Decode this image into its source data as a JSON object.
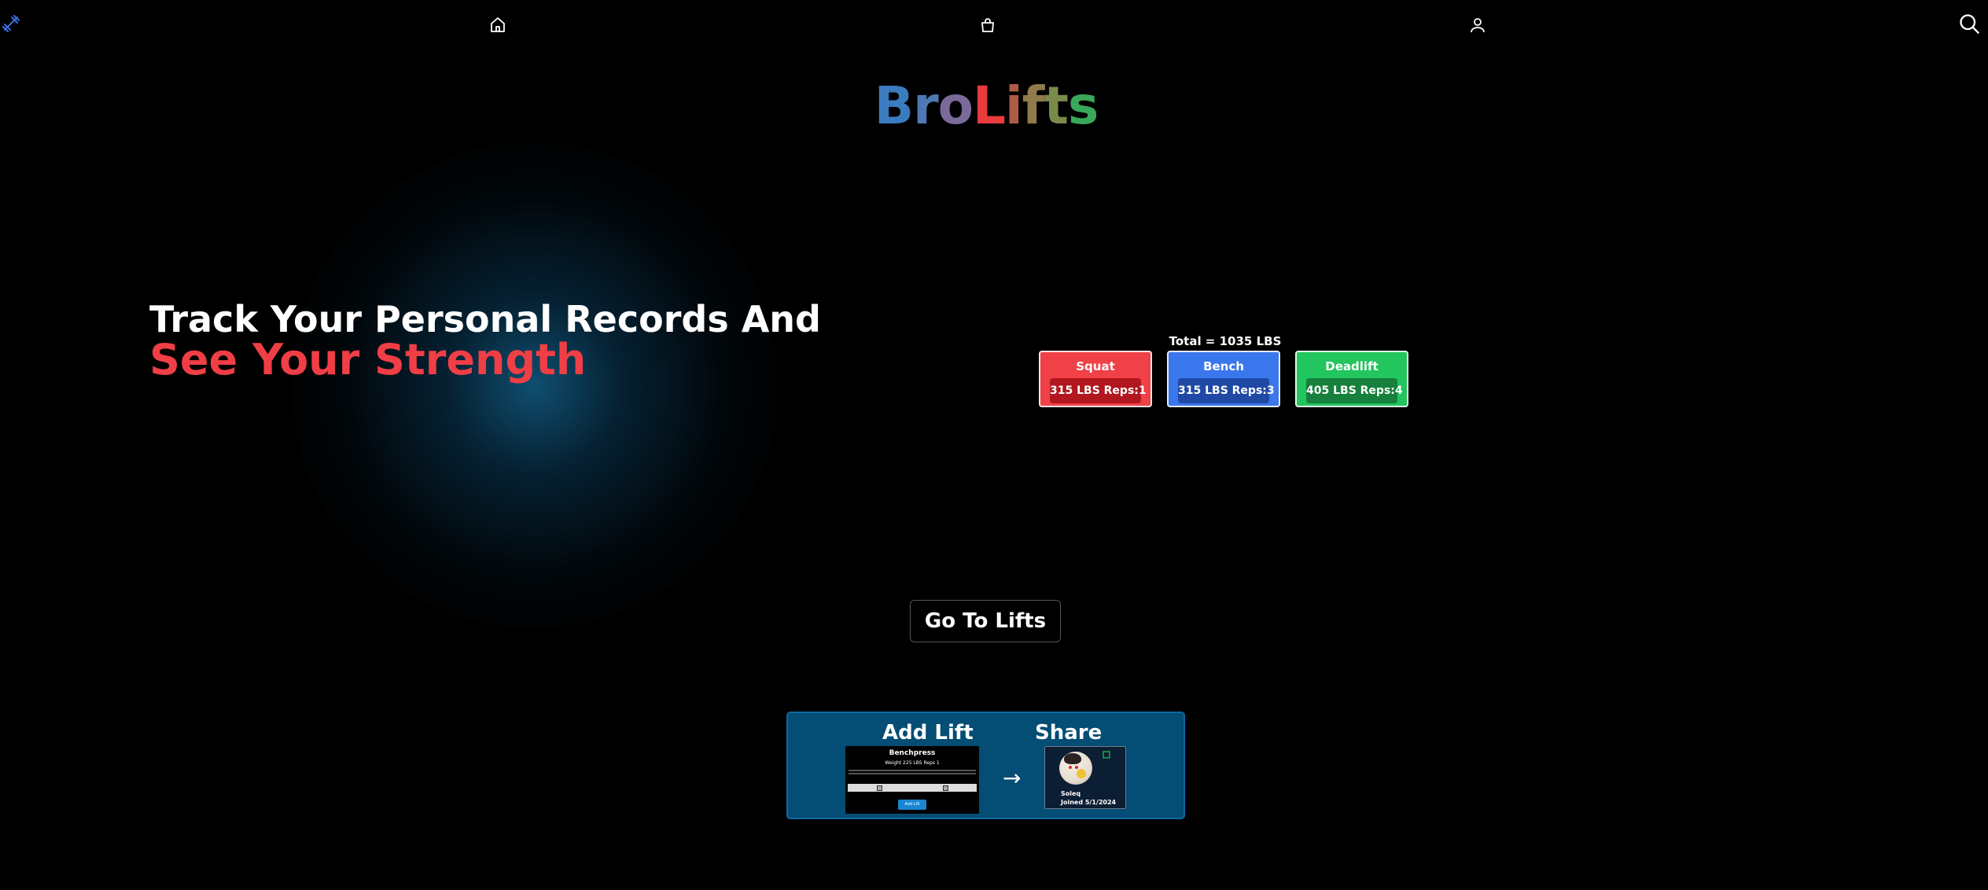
{
  "nav": {
    "items": [
      {
        "icon": "dumbbell-logo-icon"
      },
      {
        "icon": "home-icon"
      },
      {
        "icon": "shopping-bag-icon"
      },
      {
        "icon": "user-icon"
      },
      {
        "icon": "search-icon"
      }
    ]
  },
  "brand": {
    "letters": [
      {
        "char": "B",
        "color": "#3b7bbf"
      },
      {
        "char": "r",
        "color": "#4f78b5"
      },
      {
        "char": "o",
        "color": "#7a6a9a"
      },
      {
        "char": "L",
        "color": "#ea3b3e"
      },
      {
        "char": "i",
        "color": "#b05a48"
      },
      {
        "char": "f",
        "color": "#8f7a4a"
      },
      {
        "char": "t",
        "color": "#7a8a4a"
      },
      {
        "char": "s",
        "color": "#3aa85a"
      }
    ]
  },
  "hero": {
    "text_plain": "Track Your Personal Records And ",
    "text_accent": "See Your Strength",
    "accent_color": "#ef3e45"
  },
  "records": {
    "total": "Total = 1035 LBS",
    "lifts": [
      {
        "name": "Squat",
        "value": "315 LBS Reps:1",
        "color": "#ef4147"
      },
      {
        "name": "Bench",
        "value": "315 LBS Reps:3",
        "color": "#3b77ec"
      },
      {
        "name": "Deadlift",
        "value": "405 LBS Reps:4",
        "color": "#22c55e"
      }
    ]
  },
  "cta": {
    "go_label": "Go To Lifts"
  },
  "feature": {
    "add_heading": "Add Lift",
    "share_heading": "Share",
    "arrow": "→",
    "form": {
      "title": "Benchpress",
      "fields": "Weight 225 LBS Reps 1",
      "button": "Add Lift"
    },
    "profile": {
      "name": "Soleq",
      "joined": "Joined 5/1/2024"
    }
  }
}
